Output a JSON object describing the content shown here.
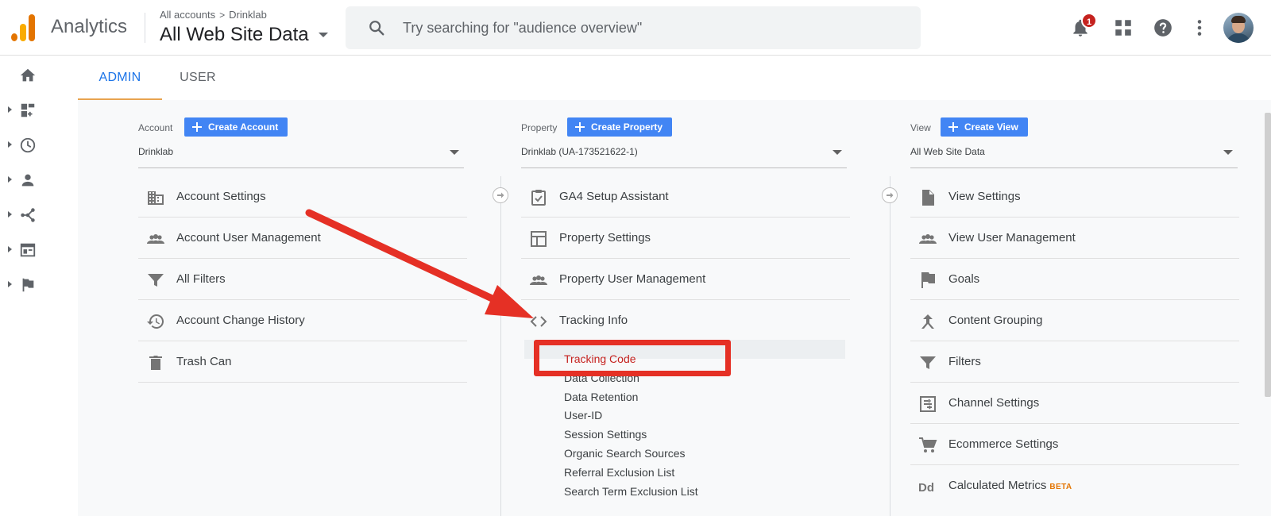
{
  "header": {
    "app_name": "Analytics",
    "crumb_all_accounts": "All accounts",
    "crumb_separator": ">",
    "crumb_account": "Drinklab",
    "view_name": "All Web Site Data",
    "search_placeholder": "Try searching for \"audience overview\"",
    "notification_count": "1"
  },
  "tabs": {
    "admin": "ADMIN",
    "user": "USER",
    "active": "ADMIN"
  },
  "account": {
    "label": "Account",
    "create_label": "Create Account",
    "selected": "Drinklab",
    "items": [
      {
        "label": "Account Settings",
        "icon": "building-icon"
      },
      {
        "label": "Account User Management",
        "icon": "people-icon"
      },
      {
        "label": "All Filters",
        "icon": "filter-icon"
      },
      {
        "label": "Account Change History",
        "icon": "history-icon"
      },
      {
        "label": "Trash Can",
        "icon": "trash-icon"
      }
    ]
  },
  "property": {
    "label": "Property",
    "create_label": "Create Property",
    "selected": "Drinklab (UA-173521622-1)",
    "items": [
      {
        "label": "GA4 Setup Assistant",
        "icon": "checklist-icon"
      },
      {
        "label": "Property Settings",
        "icon": "layout-icon"
      },
      {
        "label": "Property User Management",
        "icon": "people-icon"
      },
      {
        "label": "Tracking Info",
        "icon": "code-icon"
      }
    ],
    "tracking_sub_items": [
      "Tracking Code",
      "Data Collection",
      "Data Retention",
      "User-ID",
      "Session Settings",
      "Organic Search Sources",
      "Referral Exclusion List",
      "Search Term Exclusion List"
    ],
    "active_sub_item": "Tracking Code"
  },
  "view": {
    "label": "View",
    "create_label": "Create View",
    "selected": "All Web Site Data",
    "items": [
      {
        "label": "View Settings",
        "icon": "document-icon"
      },
      {
        "label": "View User Management",
        "icon": "people-icon"
      },
      {
        "label": "Goals",
        "icon": "flag-icon"
      },
      {
        "label": "Content Grouping",
        "icon": "grouping-icon"
      },
      {
        "label": "Filters",
        "icon": "filter-icon"
      },
      {
        "label": "Channel Settings",
        "icon": "channel-icon"
      },
      {
        "label": "Ecommerce Settings",
        "icon": "cart-icon"
      },
      {
        "label": "Calculated Metrics",
        "icon": "dd-icon",
        "badge": "BETA"
      }
    ]
  },
  "colors": {
    "accent_blue": "#1a73e8",
    "button_blue": "#4285f4",
    "annotation_red": "#e53025",
    "active_tab_underline": "#e8a34f"
  }
}
